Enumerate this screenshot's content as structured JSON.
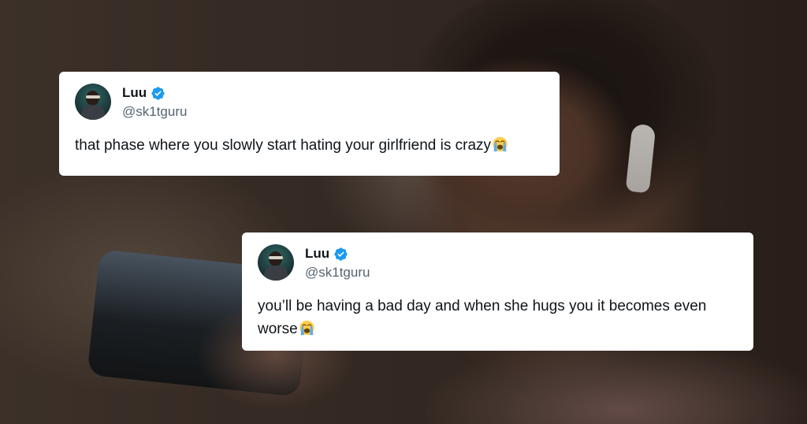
{
  "tweets": [
    {
      "name": "Luu",
      "handle": "@sk1tguru",
      "text": "that phase where you slowly start hating your girlfriend is crazy",
      "emoji": "loudly-crying-face"
    },
    {
      "name": "Luu",
      "handle": "@sk1tguru",
      "text": "you’ll be having a bad day and when she hugs you it becomes even worse",
      "emoji": "loudly-crying-face"
    }
  ],
  "colors": {
    "verified": "#1d9bf0",
    "name_text": "#0f1419",
    "handle_text": "#536471",
    "card_background": "#ffffff"
  },
  "icons": {
    "verified": "verified-badge-icon",
    "avatar": "profile-photo"
  }
}
